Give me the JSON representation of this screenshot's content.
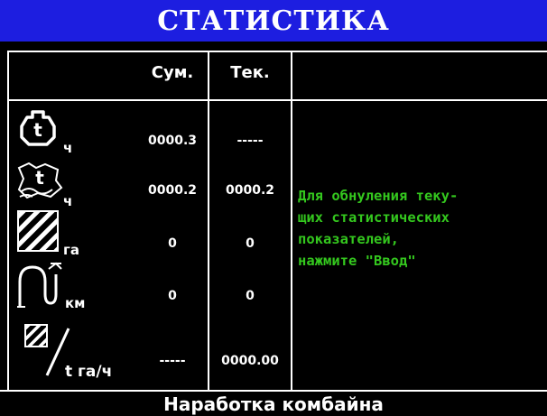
{
  "screen": {
    "title": "СТАТИСТИКА",
    "footer": "Наработка комбайна"
  },
  "columns": {
    "sum": "Сум.",
    "current": "Тек."
  },
  "rows": [
    {
      "icon": "engine-hours-icon",
      "unit": "ч",
      "sum": "0000.3",
      "current": "-----"
    },
    {
      "icon": "field-work-hours-icon",
      "unit": "ч",
      "sum": "0000.2",
      "current": "0000.2"
    },
    {
      "icon": "area-icon",
      "unit": "га",
      "sum": "0",
      "current": "0"
    },
    {
      "icon": "distance-icon",
      "unit": "км",
      "sum": "0",
      "current": "0"
    },
    {
      "icon": "productivity-icon",
      "unit": "t га/ч",
      "sum": "-----",
      "current": "0000.00"
    }
  ],
  "message": "Для обнуления теку-\nщих статистических\nпоказателей,\nнажмите \"Ввод\"",
  "colors": {
    "title_bar": "#1d1ee0",
    "background": "#000000",
    "message_text": "#34c81e",
    "text": "#ffffff"
  }
}
